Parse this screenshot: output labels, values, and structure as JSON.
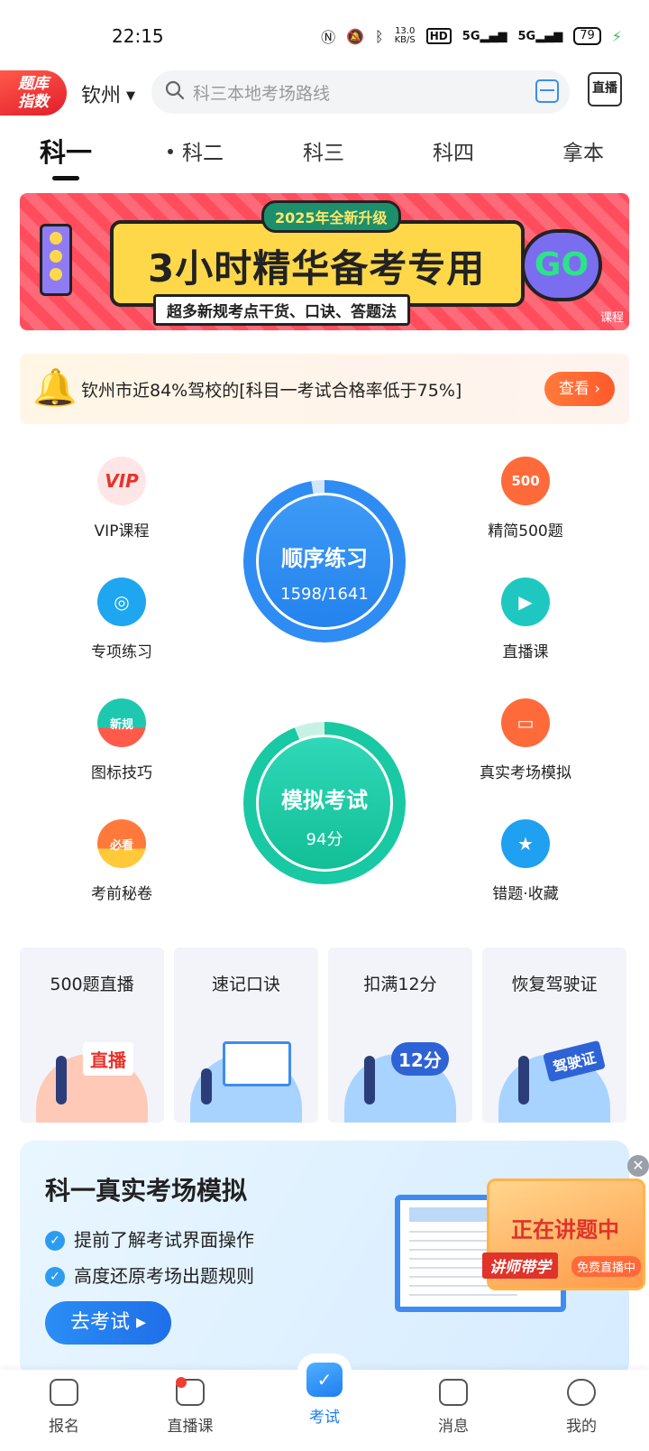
{
  "status_bar": {
    "time": "22:15",
    "net_speed": "13.0",
    "net_unit": "KB/S",
    "signal1": "5G",
    "signal2": "5G",
    "battery": "79"
  },
  "header": {
    "logo_line1": "题库",
    "logo_line2": "指数",
    "city": "钦州",
    "search_placeholder": "科三本地考场路线",
    "live_label": "直播"
  },
  "tabs": [
    {
      "label": "科一",
      "active": true
    },
    {
      "label": "科二",
      "active": false
    },
    {
      "label": "科三",
      "active": false
    },
    {
      "label": "科四",
      "active": false
    },
    {
      "label": "拿本",
      "active": false
    }
  ],
  "banner": {
    "tag": "2025年全新升级",
    "headline": "3小时精华备考专用",
    "subline": "超多新规考点干货、口诀、答题法",
    "go": "GO",
    "corner": "课程"
  },
  "notice": {
    "text": "钦州市近84%驾校的[科目一考试合格率低于75%]",
    "button": "查看 ›"
  },
  "features_left": [
    {
      "label": "VIP课程",
      "icon_text": "VIP",
      "icon": "vip-icon",
      "color": "#ffe6e6"
    },
    {
      "label": "专项练习",
      "icon_text": "◎",
      "icon": "target-icon",
      "color": "#1fa6f0"
    },
    {
      "label": "图标技巧",
      "icon_text": "新规",
      "icon": "sign-tips-icon",
      "color": "#1ec8b0"
    },
    {
      "label": "考前秘卷",
      "icon_text": "必看",
      "icon": "secret-paper-icon",
      "color": "#ff7a3a"
    }
  ],
  "features_right": [
    {
      "label": "精简500题",
      "icon_text": "500",
      "icon": "five-hundred-icon",
      "color": "#ff6a3a"
    },
    {
      "label": "直播课",
      "icon_text": "▶",
      "icon": "video-icon",
      "color": "#1ec8c0"
    },
    {
      "label": "真实考场模拟",
      "icon_text": "▭",
      "icon": "monitor-icon",
      "color": "#ff6a3a"
    },
    {
      "label": "错题·收藏",
      "icon_text": "★",
      "icon": "bookmark-icon",
      "color": "#1fa0f0"
    }
  ],
  "practice": {
    "title": "顺序练习",
    "progress": "1598/1641",
    "done": 1598,
    "total": 1641
  },
  "mock": {
    "title": "模拟考试",
    "score": "94分",
    "value": 94,
    "max": 100
  },
  "topics": [
    {
      "title": "500题直播",
      "sign": "直播",
      "blob": "#ffc9b8",
      "sign_color": "#e8332a",
      "sign_bg": "#fff"
    },
    {
      "title": "速记口诀",
      "sign": "",
      "blob": "#a9d3ff",
      "sign_color": "#1f6fe8",
      "sign_bg": "#fff"
    },
    {
      "title": "扣满12分",
      "sign": "12分",
      "blob": "#a9d3ff",
      "sign_color": "#fff",
      "sign_bg": "#2e63d6"
    },
    {
      "title": "恢复驾驶证",
      "sign": "驾驶证",
      "blob": "#a9d3ff",
      "sign_color": "#fff",
      "sign_bg": "#2e63d6"
    }
  ],
  "sim": {
    "title": "科一真实考场模拟",
    "point1": "提前了解考试界面操作",
    "point2": "高度还原考场出题规则",
    "button": "去考试 ▸"
  },
  "live_float": {
    "title": "正在讲题中",
    "teacher": "讲师带学",
    "free": "免费直播中"
  },
  "bottom_nav": [
    {
      "label": "报名",
      "active": false,
      "badge": false
    },
    {
      "label": "直播课",
      "active": false,
      "badge": true
    },
    {
      "label": "考试",
      "active": true,
      "badge": false
    },
    {
      "label": "消息",
      "active": false,
      "badge": false
    },
    {
      "label": "我的",
      "active": false,
      "badge": false
    }
  ],
  "colors": {
    "accent": "#1f7ef0",
    "practice_blue": "#2f8cf3",
    "mock_green": "#18c9a3",
    "alert": "#ff5a2a"
  }
}
